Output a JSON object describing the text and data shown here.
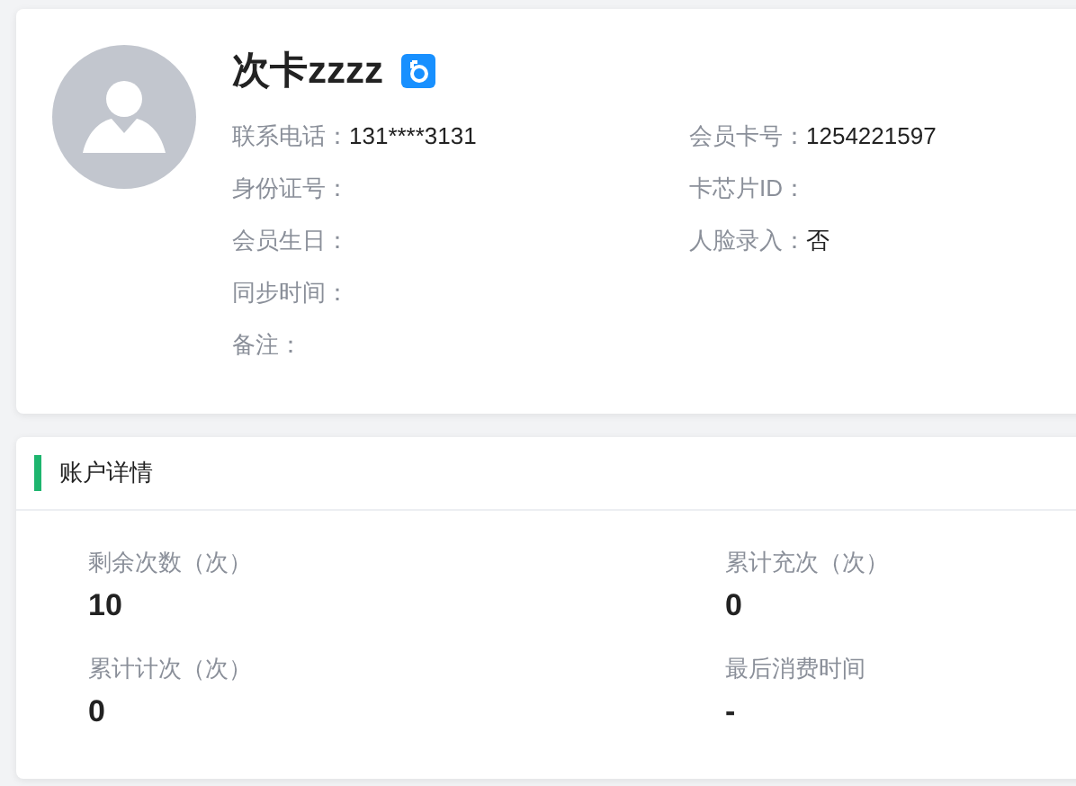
{
  "profile": {
    "name": "次卡zzzz",
    "badge": {
      "kind": "male"
    },
    "info_columns": [
      [
        {
          "label": "联系电话：",
          "value": "131****3131"
        },
        {
          "label": "身份证号："
        },
        {
          "label": "会员生日："
        },
        {
          "label": "同步时间："
        },
        {
          "label": "备注："
        }
      ],
      [
        {
          "label": "会员卡号：",
          "value": "1254221597"
        },
        {
          "label": "卡芯片ID："
        },
        {
          "label": "人脸录入：",
          "value": "否"
        }
      ]
    ]
  },
  "account": {
    "title": "账户详情",
    "stats": [
      {
        "label": "剩余次数（次）",
        "value": "10"
      },
      {
        "label": "累计充次（次）",
        "value": "0"
      },
      {
        "label": "累计计次（次）",
        "value": "0"
      },
      {
        "label": "最后消费时间",
        "value": "-"
      }
    ]
  }
}
